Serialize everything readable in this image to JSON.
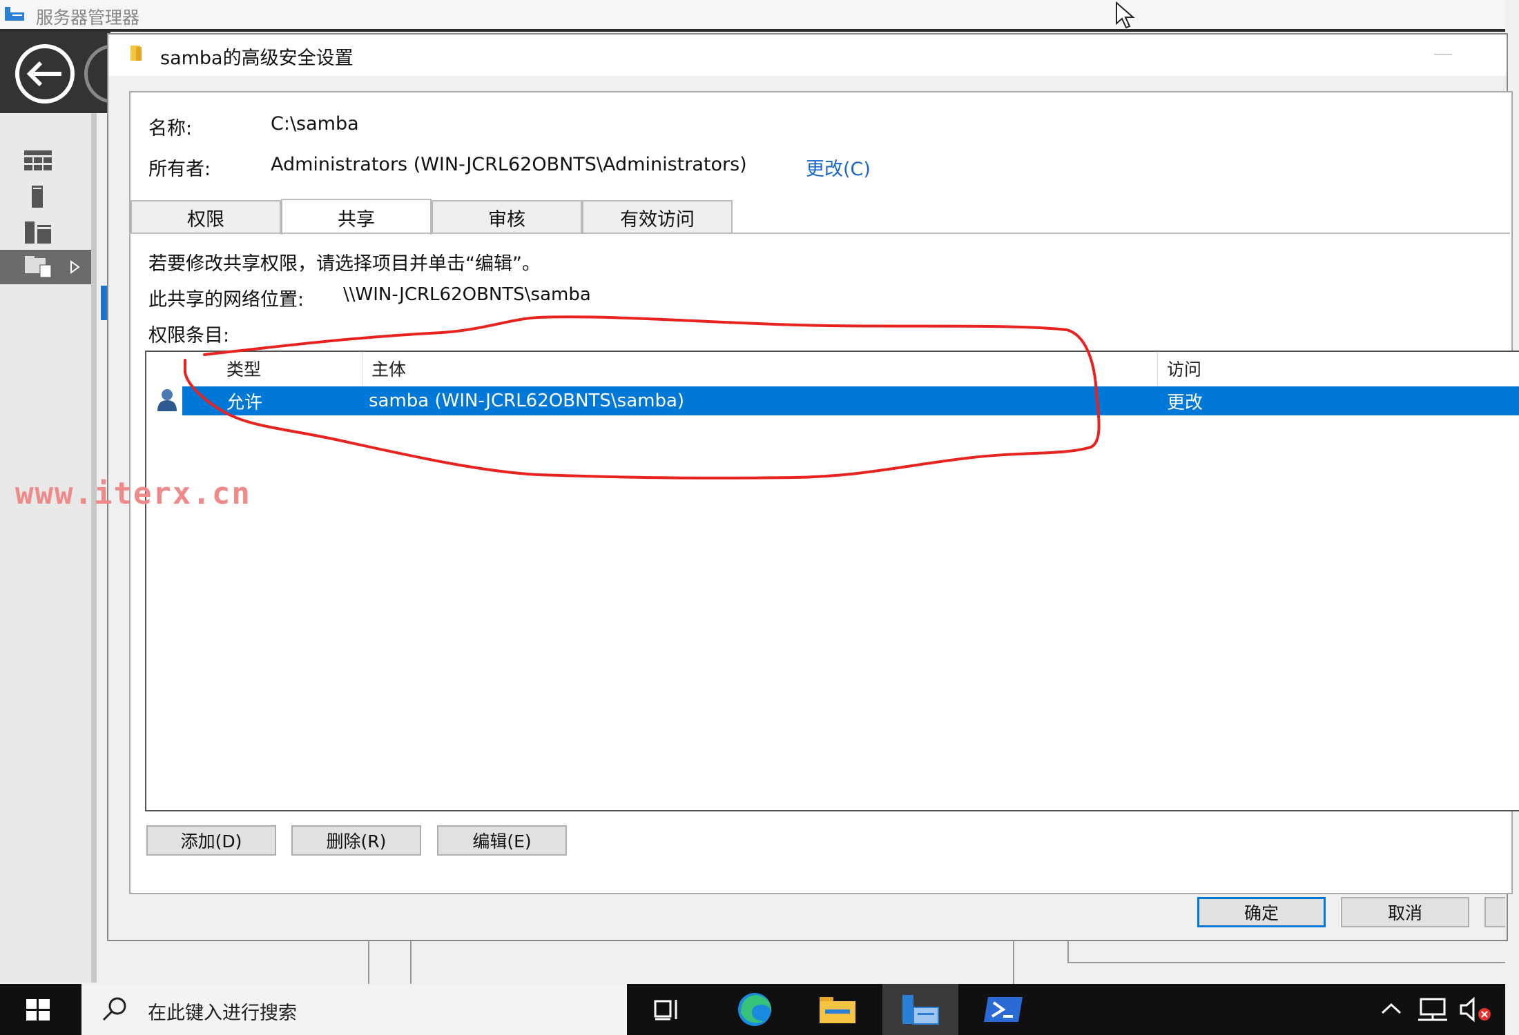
{
  "server_manager": {
    "title": "服务器管理器"
  },
  "dialog": {
    "title": "samba的高级安全设置",
    "name_label": "名称:",
    "name_value": "C:\\samba",
    "owner_label": "所有者:",
    "owner_value": "Administrators (WIN-JCRL62OBNTS\\Administrators)",
    "owner_change_link": "更改(C)",
    "tabs": [
      {
        "label": "权限",
        "selected": false
      },
      {
        "label": "共享",
        "selected": true
      },
      {
        "label": "审核",
        "selected": false
      },
      {
        "label": "有效访问",
        "selected": false
      }
    ],
    "instruction": "若要修改共享权限，请选择项目并单击“编辑”。",
    "network_location_label": "此共享的网络位置:",
    "network_location_value": "\\\\WIN-JCRL62OBNTS\\samba",
    "entries_label": "权限条目:",
    "columns": [
      "类型",
      "主体",
      "访问"
    ],
    "rows": [
      {
        "type": "允许",
        "principal": "samba (WIN-JCRL62OBNTS\\samba)",
        "access": "更改",
        "selected": true
      }
    ],
    "buttons": {
      "add": "添加(D)",
      "remove": "删除(R)",
      "edit": "编辑(E)",
      "ok": "确定",
      "cancel": "取消"
    }
  },
  "watermark": "www.iterx.cn",
  "taskbar": {
    "search_placeholder": "在此键入进行搜索"
  },
  "colors": {
    "accent": "#0078d7",
    "link": "#1a66c8",
    "annotation": "#e8231f",
    "watermark": "#f08a8a"
  }
}
